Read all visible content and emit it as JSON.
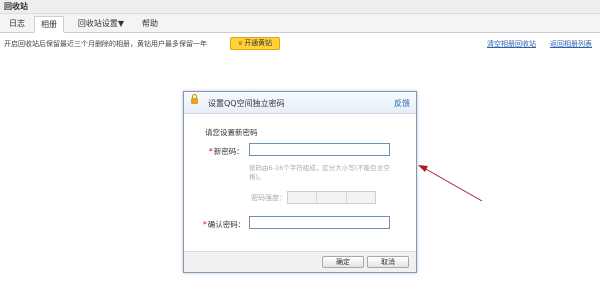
{
  "window": {
    "title": "回收站"
  },
  "tabs": [
    {
      "label": "日志"
    },
    {
      "label": "相册"
    },
    {
      "label": "回收站设置▼"
    },
    {
      "label": "帮助"
    }
  ],
  "infobar": {
    "text": "开启回收站后保留最近三个月删除的相册，黄钻用户最多保留一年",
    "vip_button": "开通黄钻",
    "link_clear": "清空相册回收站",
    "link_back": "返回相册列表"
  },
  "dialog": {
    "title": "设置QQ空间独立密码",
    "feedback": "反馈",
    "prompt": "请您设置新密码",
    "new_password_label": "新密码：",
    "hint": "密码由6-16个字符组成，区分大小写(不能包含空格)。",
    "strength_label": "密码强度：",
    "confirm_label": "确认密码：",
    "ok_button": "确定",
    "cancel_button": "取消",
    "required_mark": "*"
  },
  "colors": {
    "accent_link": "#2a62b0",
    "vip_yellow": "#ffd23c",
    "arrow": "#b0182a"
  },
  "icons": {
    "lock": "lock-icon",
    "crown": "crown-icon"
  }
}
